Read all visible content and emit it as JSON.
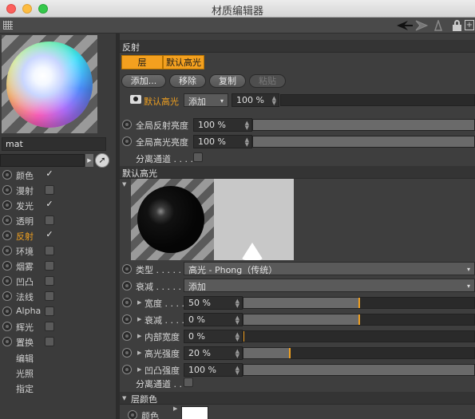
{
  "window": {
    "title": "材质编辑器"
  },
  "toolbar": {
    "icons": [
      "grid-icon",
      "arrow-left-icon",
      "arrow-right-icon",
      "up-icon",
      "lock-icon",
      "new-window-icon"
    ]
  },
  "left": {
    "material_name": "mat",
    "channels": [
      {
        "label": "颜色",
        "checked": true,
        "active": false
      },
      {
        "label": "漫射",
        "checked": false,
        "active": false
      },
      {
        "label": "发光",
        "checked": true,
        "active": false
      },
      {
        "label": "透明",
        "checked": false,
        "active": false
      },
      {
        "label": "反射",
        "checked": true,
        "active": true
      },
      {
        "label": "环境",
        "checked": false,
        "active": false
      },
      {
        "label": "烟雾",
        "checked": false,
        "active": false
      },
      {
        "label": "凹凸",
        "checked": false,
        "active": false
      },
      {
        "label": "法线",
        "checked": false,
        "active": false
      },
      {
        "label": "Alpha",
        "checked": false,
        "active": false
      },
      {
        "label": "辉光",
        "checked": false,
        "active": false
      },
      {
        "label": "置换",
        "checked": false,
        "active": false
      }
    ],
    "extras": [
      "编辑",
      "光照",
      "指定"
    ],
    "check_mark": "✓"
  },
  "right": {
    "section_reflect": "反射",
    "tabs": [
      "层",
      "默认高光"
    ],
    "buttons": {
      "add": "添加...",
      "remove": "移除",
      "copy": "复制",
      "paste": "粘贴"
    },
    "layer": {
      "name": "默认高光",
      "mode": "添加",
      "opacity": "100 %"
    },
    "global_reflect": {
      "label": "全局反射亮度",
      "value": "100 %"
    },
    "global_spec": {
      "label": "全局高光亮度",
      "value": "100 %"
    },
    "separate_pass": "分离通道 . . . .",
    "section_default_spec": "默认高光",
    "type": {
      "label": "类型  . . . . .",
      "value": "高光 - Phong（传统）"
    },
    "attenuation": {
      "label": "衰减  . . . . .",
      "value": "添加"
    },
    "width": {
      "label": "宽度 . . . . .",
      "value": "50 %",
      "fraction": 0.5
    },
    "falloff": {
      "label": "衰减 . . . . .",
      "value": "0 %",
      "fraction": 0.5
    },
    "inner_width": {
      "label": "内部宽度",
      "value": "0 %",
      "fraction": 0.0
    },
    "spec_strength": {
      "label": "高光强度",
      "value": "20 %",
      "fraction": 0.2
    },
    "bump_strength": {
      "label": "凹凸强度",
      "value": "100 %",
      "fraction": 1.0
    },
    "separate_pass2": "分离通道 . .",
    "section_layer_color": "层颜色",
    "color_label": "颜色",
    "color_value": "#ffffff"
  }
}
